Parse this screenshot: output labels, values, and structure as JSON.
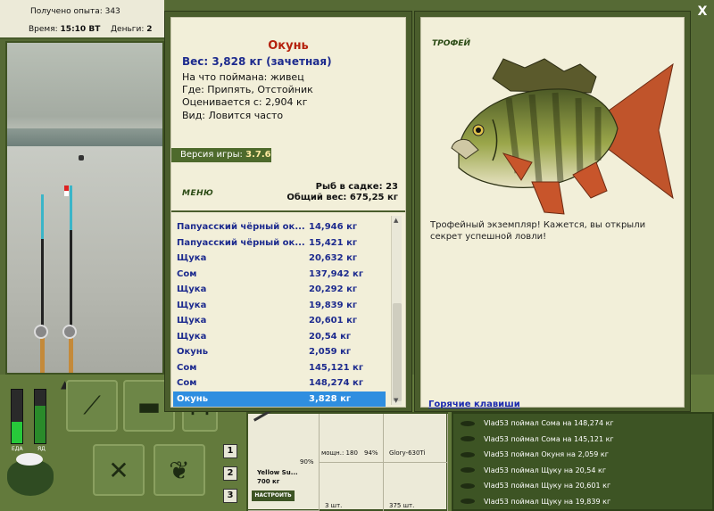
{
  "hud": {
    "xp_label": "Получено опыта: 343",
    "time_label": "Время:",
    "time_value": "15:10 ВТ",
    "money_label": "Деньги:",
    "money_value": "2",
    "food_label": "ЕДА",
    "poison_label": "ЯД"
  },
  "catch_info": {
    "fish_name": "Окунь",
    "weight_line": "Вес: 3,828 кг (зачетная)",
    "bait_line": "На что поймана: живец",
    "place_line": "Где: Припять, Отстойник",
    "value_line": "Оценивается с: 2,904 кг",
    "kind_line": "Вид: Ловится часто",
    "version_label": "Версия игры:",
    "version_value": "3.7.6",
    "menu_label": "МЕНЮ",
    "fish_in_keepnet": "Рыб в садке: 23",
    "total_weight": "Общий вес: 675,25 кг"
  },
  "catch_list": [
    {
      "name": "Папуасский чёрный ок...",
      "weight": "14,946 кг"
    },
    {
      "name": "Папуасский чёрный ок...",
      "weight": "15,421 кг"
    },
    {
      "name": "Щука",
      "weight": "20,632 кг"
    },
    {
      "name": "Сом",
      "weight": "137,942 кг"
    },
    {
      "name": "Щука",
      "weight": "20,292 кг"
    },
    {
      "name": "Щука",
      "weight": "19,839 кг"
    },
    {
      "name": "Щука",
      "weight": "20,601 кг"
    },
    {
      "name": "Щука",
      "weight": "20,54 кг"
    },
    {
      "name": "Окунь",
      "weight": "2,059 кг"
    },
    {
      "name": "Сом",
      "weight": "145,121 кг"
    },
    {
      "name": "Сом",
      "weight": "148,274 кг"
    },
    {
      "name": "Окунь",
      "weight": "3,828 кг"
    }
  ],
  "trophy": {
    "heading": "ТРОФЕЙ",
    "text": "Трофейный экземпляр! Кажется, вы открыли секрет успешной ловли!",
    "hotkeys_link": "Горячие клавиши",
    "close_glyph": "X"
  },
  "tackle": {
    "rod_name": "Yellow Su...",
    "rod_weight": "700 кг",
    "rod_condition": "90%",
    "setup_button": "НАСТРОИТЬ",
    "reel_power": "мощн.: 180",
    "reel_condition": "94%",
    "line_name": "Glory-630Ti",
    "hooks_count": "3 шт.",
    "bait_count": "375 шт."
  },
  "tabs": [
    "1",
    "2",
    "3"
  ],
  "chat": [
    "Vlad53 поймал Сома на 148,274 кг",
    "Vlad53 поймал Сома на 145,121 кг",
    "Vlad53 поймал Окуня на 2,059 кг",
    "Vlad53 поймал Щуку на 20,54 кг",
    "Vlad53 поймал Щуку на 20,601 кг",
    "Vlad53 поймал Щуку на 19,839 кг"
  ],
  "meters": {
    "food_level": 0.4,
    "poison_level": 0.7
  },
  "colors": {
    "panel_green": "#4a5d2c",
    "paper": "#f2efd9",
    "selection": "#2f8ee0",
    "fish_title": "#b5220e",
    "list_text": "#1d2b8e"
  }
}
